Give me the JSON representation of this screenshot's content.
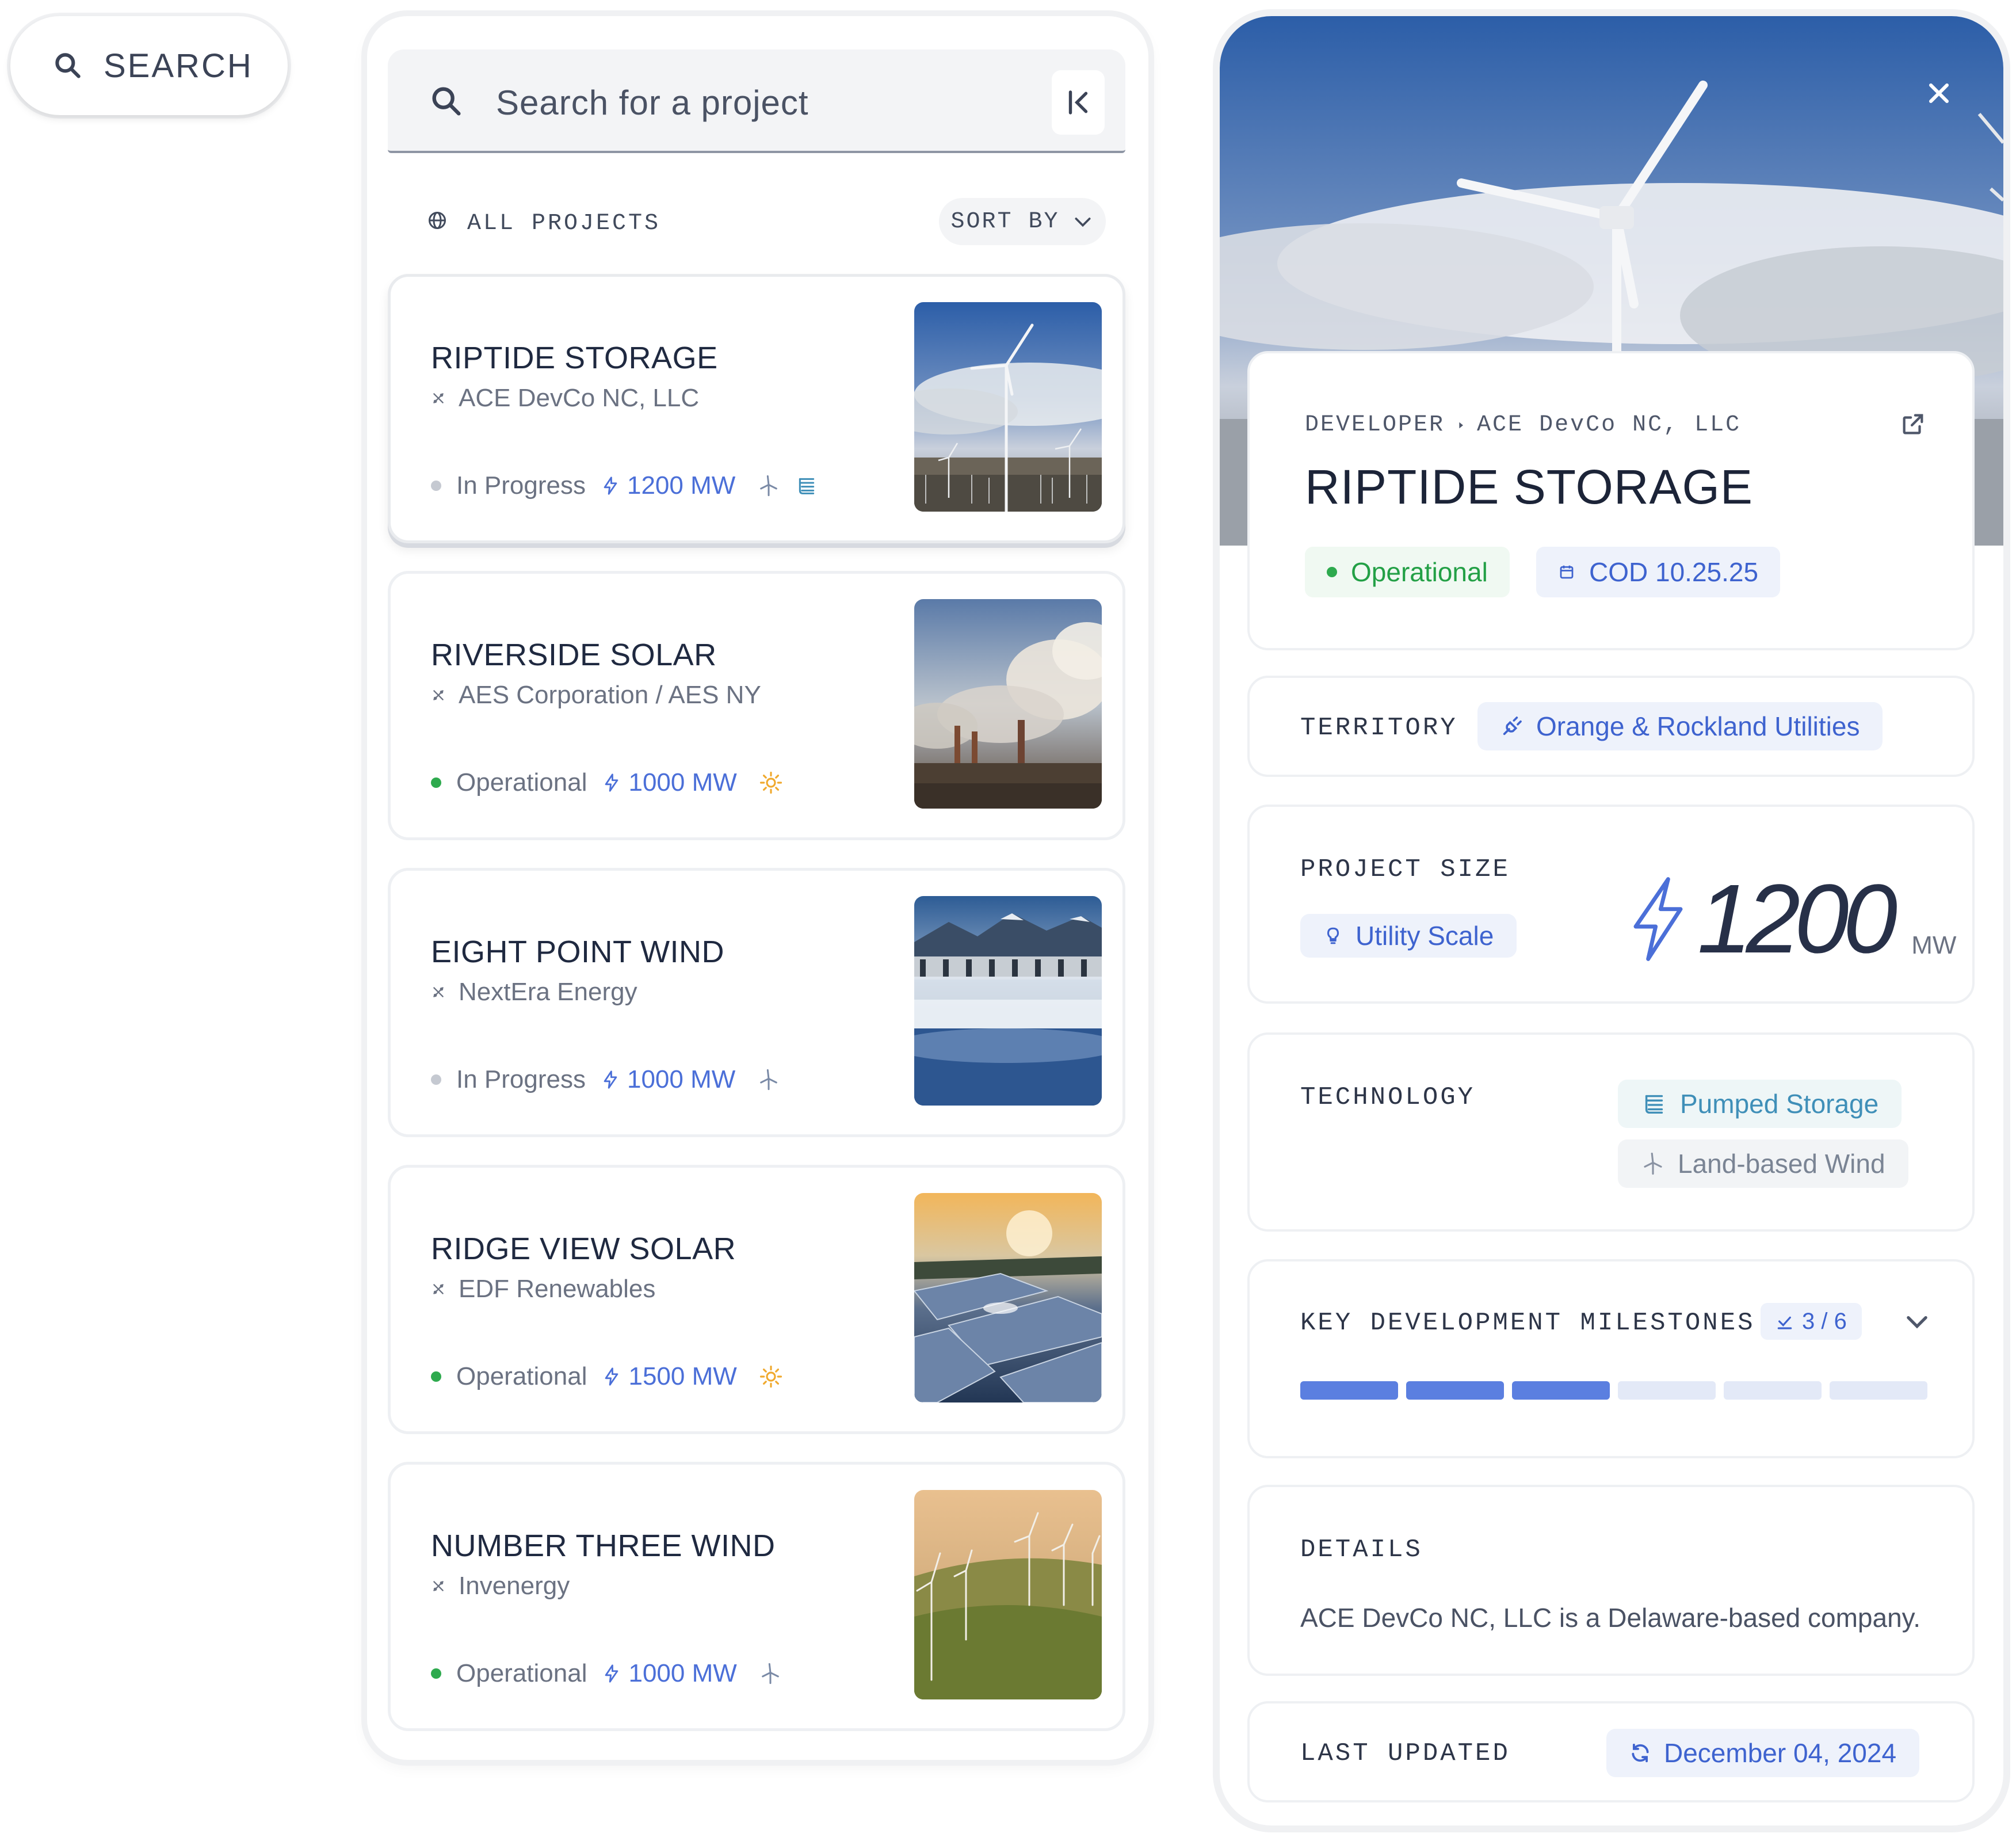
{
  "search_pill": {
    "label": "SEARCH"
  },
  "list": {
    "search_placeholder": "Search for a project",
    "filter_label": "ALL PROJECTS",
    "sort_label": "SORT BY",
    "projects": [
      {
        "title": "RIPTIDE STORAGE",
        "developer": "ACE DevCo NC, LLC",
        "status": "In Progress",
        "status_color": "#c5c9d1",
        "mw": "1200 MW",
        "tech": [
          "wind-turbine-icon",
          "pumped-storage-icon"
        ]
      },
      {
        "title": "RIVERSIDE SOLAR",
        "developer": "AES Corporation / AES NY",
        "status": "Operational",
        "status_color": "#2eaa4e",
        "mw": "1000 MW",
        "tech": [
          "sun-icon"
        ]
      },
      {
        "title": "EIGHT POINT WIND",
        "developer": "NextEra Energy",
        "status": "In Progress",
        "status_color": "#c5c9d1",
        "mw": "1000 MW",
        "tech": [
          "wind-turbine-icon"
        ]
      },
      {
        "title": "RIDGE VIEW SOLAR",
        "developer": "EDF Renewables",
        "status": "Operational",
        "status_color": "#2eaa4e",
        "mw": "1500 MW",
        "tech": [
          "sun-icon"
        ]
      },
      {
        "title": "NUMBER THREE WIND",
        "developer": "Invenergy",
        "status": "Operational",
        "status_color": "#2eaa4e",
        "mw": "1000 MW",
        "tech": [
          "wind-turbine-icon"
        ]
      }
    ]
  },
  "detail": {
    "breadcrumb_label": "DEVELOPER",
    "breadcrumb_value": "ACE DevCo NC, LLC",
    "title": "RIPTIDE STORAGE",
    "status": "Operational",
    "cod": "COD 10.25.25",
    "territory_label": "TERRITORY",
    "territory_value": "Orange & Rockland Utilities",
    "size_label": "PROJECT SIZE",
    "size_class": "Utility Scale",
    "size_value": "1200",
    "size_unit": "MW",
    "technology_label": "TECHNOLOGY",
    "technologies": [
      "Pumped Storage",
      "Land-based Wind"
    ],
    "milestones_label": "KEY DEVELOPMENT MILESTONES",
    "milestones_count": "3 / 6",
    "milestones_done": 3,
    "milestones_total": 6,
    "details_label": "DETAILS",
    "details_text": "ACE DevCo NC, LLC is a Delaware-based company.",
    "updated_label": "LAST UPDATED",
    "updated_value": "December 04, 2024"
  },
  "colors": {
    "accent": "#4b6fd8",
    "success": "#2eaa4e",
    "muted": "#6b7282"
  }
}
